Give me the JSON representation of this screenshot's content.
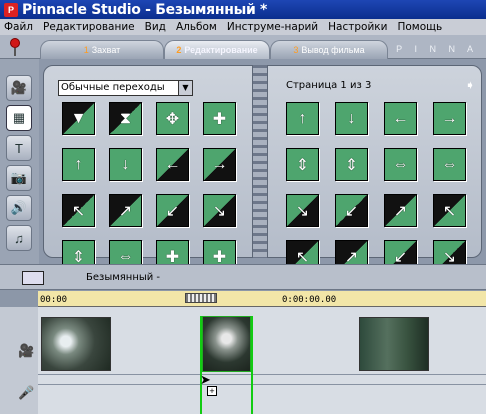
{
  "app": {
    "title": "Pinnacle Studio - Безымянный *"
  },
  "menu": [
    "Файл",
    "Редактирование",
    "Вид",
    "Альбом",
    "Инструме-нарий",
    "Настройки",
    "Помощь"
  ],
  "tabs": [
    {
      "num": "1",
      "label": "Захват"
    },
    {
      "num": "2",
      "label": "Редактирование"
    },
    {
      "num": "3",
      "label": "Вывод фильма"
    }
  ],
  "logo": "P I N N A",
  "album": {
    "dropdown_value": "Обычные переходы",
    "page_label": "Страница 1 из 3",
    "left_tiles": [
      {
        "style": "gb",
        "glyph": "▼"
      },
      {
        "style": "gb",
        "glyph": "⧗"
      },
      {
        "style": "g",
        "glyph": "✥"
      },
      {
        "style": "g",
        "glyph": "✚"
      },
      {
        "style": "g",
        "glyph": "↑"
      },
      {
        "style": "g",
        "glyph": "↓"
      },
      {
        "style": "bg",
        "glyph": "←"
      },
      {
        "style": "bg",
        "glyph": "→"
      },
      {
        "style": "gb",
        "glyph": "↖"
      },
      {
        "style": "gb",
        "glyph": "↗"
      },
      {
        "style": "bg",
        "glyph": "↙"
      },
      {
        "style": "bg",
        "glyph": "↘"
      },
      {
        "style": "g",
        "glyph": "⇕"
      },
      {
        "style": "g",
        "glyph": "⇔"
      },
      {
        "style": "g",
        "glyph": "✚"
      },
      {
        "style": "g",
        "glyph": "✚"
      }
    ],
    "right_tiles": [
      {
        "style": "g",
        "glyph": "↑"
      },
      {
        "style": "g",
        "glyph": "↓"
      },
      {
        "style": "g",
        "glyph": "←"
      },
      {
        "style": "g",
        "glyph": "→"
      },
      {
        "style": "g",
        "glyph": "⇕"
      },
      {
        "style": "g",
        "glyph": "⇕"
      },
      {
        "style": "g",
        "glyph": "⇔"
      },
      {
        "style": "g",
        "glyph": "⇔"
      },
      {
        "style": "bg",
        "glyph": "↘"
      },
      {
        "style": "bg",
        "glyph": "↙"
      },
      {
        "style": "gb",
        "glyph": "↗"
      },
      {
        "style": "gb",
        "glyph": "↖"
      },
      {
        "style": "gb",
        "glyph": "↖"
      },
      {
        "style": "gb",
        "glyph": "↗"
      },
      {
        "style": "bg",
        "glyph": "↙"
      },
      {
        "style": "bg",
        "glyph": "↘"
      }
    ]
  },
  "movie": {
    "title": "Безымянный -",
    "ruler": {
      "start": "00:00",
      "mid": "0:00:00.00"
    }
  },
  "sidebar_icons": [
    "video-camera-icon",
    "transitions-icon",
    "titles-icon",
    "still-images-icon",
    "sound-effects-icon",
    "music-icon"
  ],
  "colors": {
    "accent_green": "#4ea56e",
    "playhead": "#11cc11",
    "title_bar": "#1e46b4"
  }
}
